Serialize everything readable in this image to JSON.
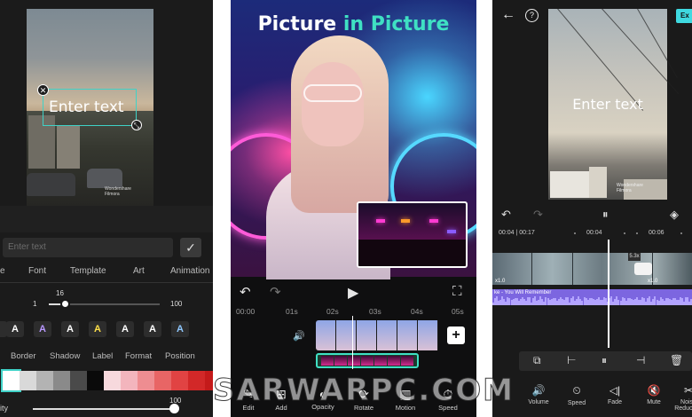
{
  "panel1": {
    "overlay_text": "Enter text",
    "watermark": [
      "Wondershare",
      "Filmora"
    ],
    "input_placeholder": "Enter text",
    "check_icon": "✓",
    "tabs": [
      "e",
      "Font",
      "Template",
      "Art",
      "Animation"
    ],
    "size_value": "16",
    "size_min": "1",
    "size_max": "100",
    "size_level": 0.15,
    "style_letters": [
      "A",
      "A",
      "A",
      "A",
      "A",
      "A",
      "A"
    ],
    "style_colors": [
      "#ffffff",
      "#b998ff",
      "#ffffff",
      "#ffe14a",
      "#ffffff",
      "#ffffff",
      "#8fc8ff"
    ],
    "sub_tabs": [
      "Border",
      "Shadow",
      "Label",
      "Format",
      "Position"
    ],
    "swatch_colors": [
      "#ffffff",
      "#d9d9d9",
      "#b3b3b3",
      "#8a8a8a",
      "#4a4a4a",
      "#0a0a0a",
      "#f7d9dd",
      "#f3b5bd",
      "#ee8d91",
      "#e86565",
      "#e14343",
      "#d22828",
      "#c41a1a"
    ],
    "opacity_value": "100",
    "opacity_label": "ity",
    "opacity_level": 1.0
  },
  "panel2": {
    "title_part1": "Picture ",
    "title_part2": "in Picture",
    "title_color1": "#ffffff",
    "title_color2": "#3fe0c3",
    "controls": [
      "↶",
      "↷",
      "▶",
      "⛶"
    ],
    "ticks": [
      "00:00",
      "01s",
      "02s",
      "03s",
      "04s",
      "05s"
    ],
    "volume_icon": "🔊",
    "add_icon": "+",
    "tools": [
      {
        "icon": "✎",
        "label": "Edit"
      },
      {
        "icon": "⊞",
        "label": "Add"
      },
      {
        "icon": "◐",
        "label": "Opacity"
      },
      {
        "icon": "⟳",
        "label": "Rotate"
      },
      {
        "icon": "▥",
        "label": "Motion"
      },
      {
        "icon": "⏱",
        "label": "Speed"
      }
    ]
  },
  "panel3": {
    "back_icon": "←",
    "help_icon": "?",
    "export_label": "Ex",
    "overlay_text": "Enter text",
    "watermark": [
      "Wondershare",
      "Filmora"
    ],
    "controls": [
      "↶",
      "↷",
      "⏸",
      "◈"
    ],
    "time_display": "00:04 | 00:17",
    "ticks": [
      "00:04",
      "00:06"
    ],
    "speed_badge": "5.3x",
    "clip_speed_a": "x1.0",
    "clip_speed_b": "x1.0",
    "audio_label": "ke - You Will Remember",
    "toolbar_icons": [
      "⧉",
      "⊢",
      "⏸",
      "⊣",
      "🗑"
    ],
    "tools": [
      {
        "icon": "🔊",
        "label": "Volume"
      },
      {
        "icon": "⏲",
        "label": "Speed"
      },
      {
        "icon": "◁|",
        "label": "Fade"
      },
      {
        "icon": "🔇",
        "label": "Mute"
      },
      {
        "icon": "✂",
        "label": "Noise Reduction"
      }
    ]
  },
  "site_watermark": "SARWARPC.COM"
}
